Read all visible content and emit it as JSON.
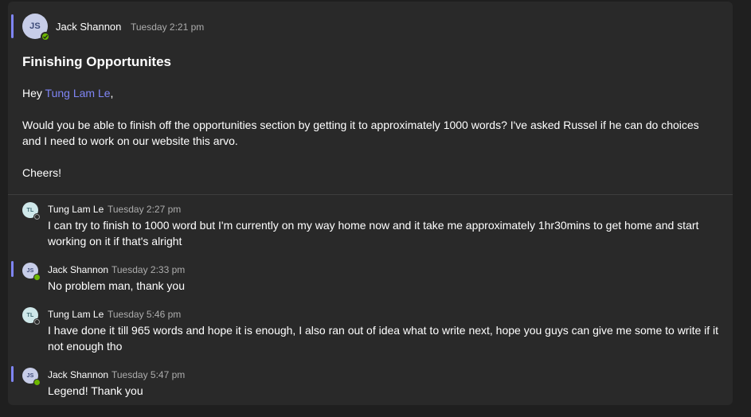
{
  "thread": {
    "root": {
      "author": "Jack Shannon",
      "initials": "JS",
      "time": "Tuesday 2:21 pm",
      "subject": "Finishing Opportunites",
      "greeting_prefix": "Hey ",
      "mention": "Tung Lam Le",
      "greeting_suffix": ",",
      "paragraph": "Would you be able to finish off the opportunities section by getting it to approximately 1000 words? I've asked Russel if he can do choices and I need to work on our website this arvo.",
      "signoff": "Cheers!",
      "presence": "available"
    },
    "replies": [
      {
        "author": "Tung Lam Le",
        "initials": "TL",
        "time": "Tuesday 2:27 pm",
        "text": "I can try to finish to 1000 word but I'm currently on my way home now and it take me approximately 1hr30mins to get home and start working on it if that's alright",
        "presence": "offline"
      },
      {
        "author": "Jack Shannon",
        "initials": "JS",
        "time": "Tuesday 2:33 pm",
        "text": "No problem man, thank you",
        "presence": "available"
      },
      {
        "author": "Tung Lam Le",
        "initials": "TL",
        "time": "Tuesday 5:46 pm",
        "text": "I have done it till 965 words and hope it is enough, I also ran out of idea what to write next, hope you guys can give me some to write if it not enough tho",
        "presence": "offline"
      },
      {
        "author": "Jack Shannon",
        "initials": "JS",
        "time": "Tuesday 5:47 pm",
        "text": "Legend! Thank you",
        "presence": "available"
      }
    ]
  },
  "colors": {
    "background": "#1f1f1f",
    "card": "#292929",
    "accent": "#7f85f5",
    "mention": "#7f85f5",
    "available": "#6bb700",
    "timestamp": "#adadad"
  },
  "icons": {
    "available": "checkmark-icon",
    "offline": "offline-ring-icon"
  }
}
